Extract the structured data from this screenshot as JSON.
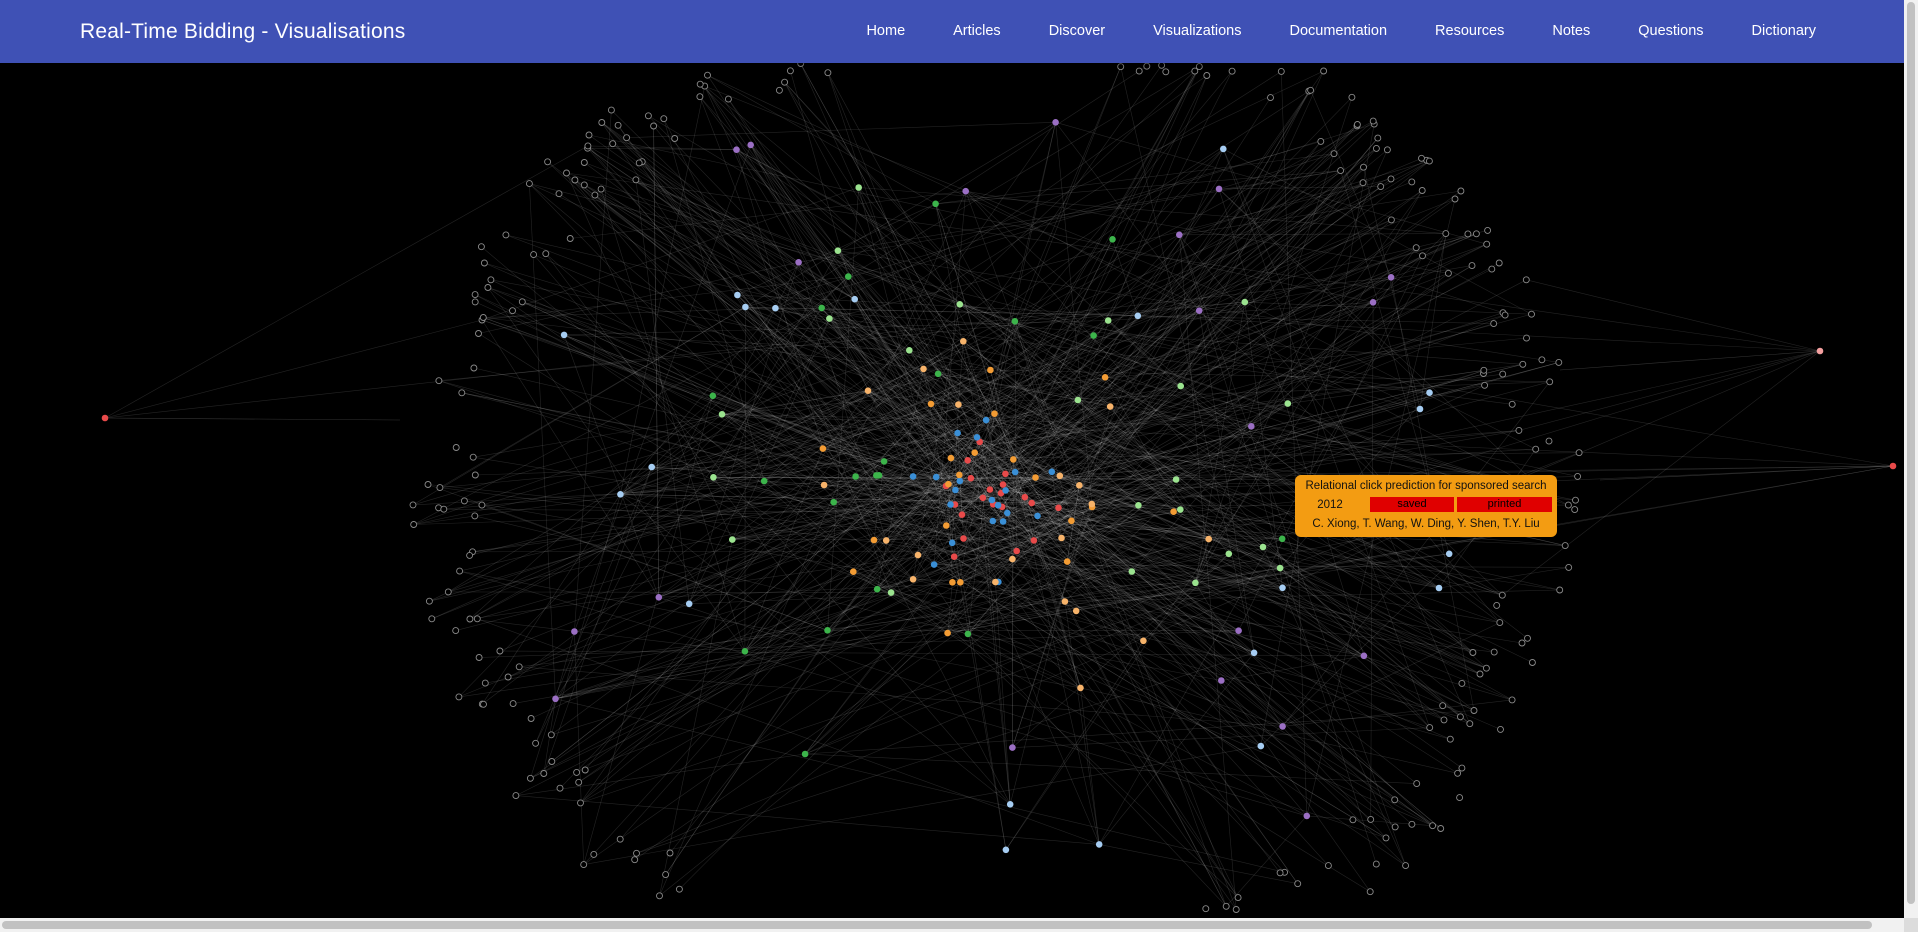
{
  "app": {
    "title": "Real-Time Bidding - Visualisations"
  },
  "nav": {
    "items": [
      {
        "label": "Home"
      },
      {
        "label": "Articles"
      },
      {
        "label": "Discover"
      },
      {
        "label": "Visualizations"
      },
      {
        "label": "Documentation"
      },
      {
        "label": "Resources"
      },
      {
        "label": "Notes"
      },
      {
        "label": "Questions"
      },
      {
        "label": "Dictionary"
      }
    ]
  },
  "tooltip": {
    "title": "Relational click prediction for sponsored search",
    "year": "2012",
    "saved_label": "saved",
    "printed_label": "printed",
    "authors": "C. Xiong, T. Wang, W. Ding, Y. Shen, T.Y. Liu"
  },
  "graph_colors": {
    "background": "#000000",
    "link": "#ffffff",
    "outer_node_stroke": "#8a8a8a",
    "navbar": "#3f51b5",
    "tooltip": "#f39c12",
    "badge": "#e00000",
    "node_groups": [
      "#e84a4a",
      "#3a8fd6",
      "#f39c34",
      "#f7b36a",
      "#3cb44b",
      "#9be38f",
      "#a6cdf2",
      "#9b6fc4",
      "#f4a0a0"
    ]
  }
}
